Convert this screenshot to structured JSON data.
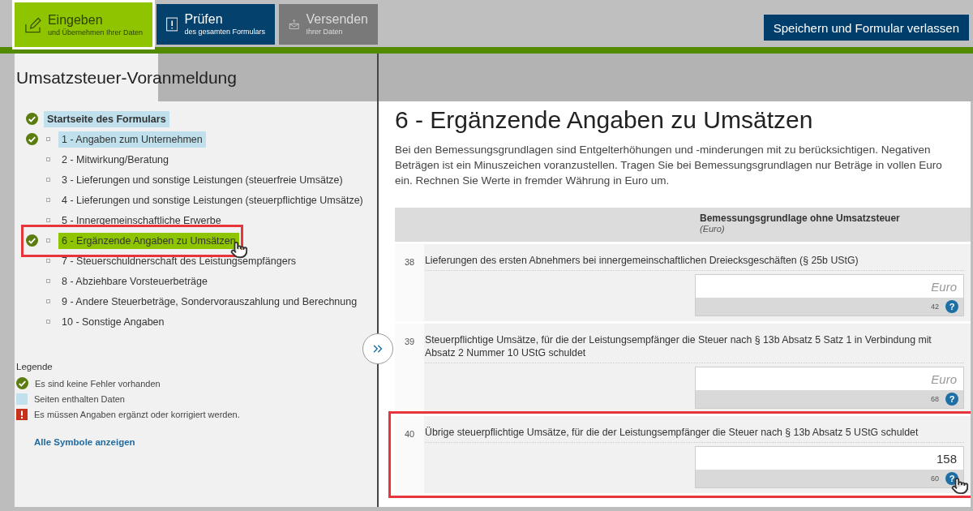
{
  "steps": [
    {
      "kind": "edit",
      "title": "Eingeben",
      "subtitle": "und Übernehmen Ihrer Daten",
      "selected": true
    },
    {
      "kind": "check",
      "title": "Prüfen",
      "subtitle": "des gesamten Formulars",
      "selected": false
    },
    {
      "kind": "send",
      "title": "Versenden",
      "subtitle": "Ihrer Daten",
      "selected": false
    }
  ],
  "save_button": "Speichern und Formular verlassen",
  "form_title": "Umsatzsteuer-Voranmeldung",
  "nav": [
    {
      "label": "Startseite des Formulars",
      "ok": true,
      "has_data": true,
      "selected": false,
      "bullet": false,
      "highlighted": false
    },
    {
      "label": "1 - Angaben zum Unternehmen",
      "ok": true,
      "has_data": true,
      "selected": false,
      "bullet": true,
      "highlighted": false
    },
    {
      "label": "2 - Mitwirkung/Beratung",
      "ok": false,
      "has_data": false,
      "selected": false,
      "bullet": true,
      "highlighted": false
    },
    {
      "label": "3 - Lieferungen und sonstige Leistungen (steuerfreie Umsätze)",
      "ok": false,
      "has_data": false,
      "selected": false,
      "bullet": true,
      "highlighted": false
    },
    {
      "label": "4 - Lieferungen und sonstige Leistungen (steuerpflichtige Umsätze)",
      "ok": false,
      "has_data": false,
      "selected": false,
      "bullet": true,
      "highlighted": false
    },
    {
      "label": "5 - Innergemeinschaftliche Erwerbe",
      "ok": false,
      "has_data": false,
      "selected": false,
      "bullet": true,
      "highlighted": false
    },
    {
      "label": "6 - Ergänzende Angaben zu Umsätzen",
      "ok": true,
      "has_data": true,
      "selected": true,
      "bullet": true,
      "highlighted": true
    },
    {
      "label": "7 - Steuerschuldnerschaft des Leistungsempfängers",
      "ok": false,
      "has_data": false,
      "selected": false,
      "bullet": true,
      "highlighted": false
    },
    {
      "label": "8 - Abziehbare Vorsteuerbeträge",
      "ok": false,
      "has_data": false,
      "selected": false,
      "bullet": true,
      "highlighted": false
    },
    {
      "label": "9 - Andere Steuerbeträge, Sondervorauszahlung und Berechnung",
      "ok": false,
      "has_data": false,
      "selected": false,
      "bullet": true,
      "highlighted": false
    },
    {
      "label": "10 - Sonstige Angaben",
      "ok": false,
      "has_data": false,
      "selected": false,
      "bullet": true,
      "highlighted": false
    }
  ],
  "legend": {
    "title": "Legende",
    "items": [
      {
        "kind": "ok",
        "text": "Es sind keine Fehler vorhanden"
      },
      {
        "kind": "data",
        "text": "Seiten enthalten Daten"
      },
      {
        "kind": "error",
        "text": "Es müssen Angaben ergänzt oder korrigiert werden."
      }
    ],
    "link": "Alle Symbole anzeigen"
  },
  "page": {
    "heading": "6 - Ergänzende Angaben zu Umsätzen",
    "intro": "Bei den Bemessungsgrundlagen sind Entgelterhöhungen und -minderungen mit zu berücksichtigen. Negativen Beträgen ist ein Minuszeichen voranzustellen. Tragen Sie bei Bemessungsgrundlagen nur Beträge in vollen Euro ein. Rechnen Sie Werte in fremder Währung in Euro um.",
    "column_header": "Bemessungsgrundlage ohne Umsatzsteuer",
    "column_unit": "(Euro)",
    "rows": [
      {
        "number": "38",
        "label": "Lieferungen des ersten Abnehmers bei innergemeinschaftlichen Dreiecksgeschäften (§ 25b UStG)",
        "placeholder": "Euro",
        "code": "42",
        "help": "?",
        "highlighted": false
      },
      {
        "number": "39",
        "label": "Steuerpflichtige Umsätze, für die der Leistungsempfänger die Steuer nach § 13b Absatz 5 Satz 1 in Verbindung mit Absatz 2 Nummer 10 UStG schuldet",
        "placeholder": "Euro",
        "code": "68",
        "help": "?",
        "highlighted": false
      },
      {
        "number": "40",
        "label": "Übrige steuerpflichtige Umsätze, für die der Leistungsempfänger die Steuer nach § 13b Absatz 5 UStG schuldet",
        "value": "158",
        "code": "60",
        "help": "?",
        "highlighted": true
      }
    ]
  }
}
